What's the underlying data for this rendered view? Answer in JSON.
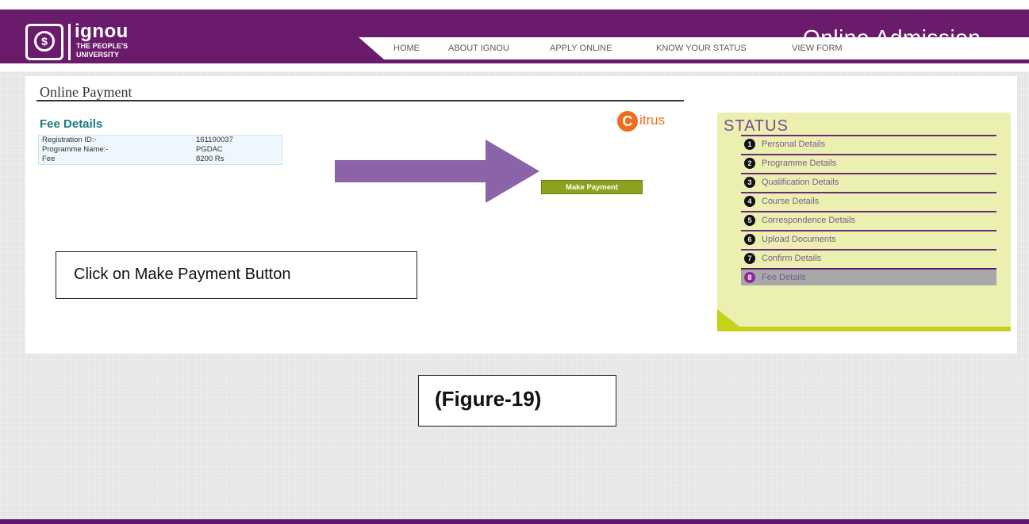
{
  "header": {
    "logo_word": "ignou",
    "logo_sub1": "THE PEOPLE'S",
    "logo_sub2": "UNIVERSITY",
    "site_title": "Online Admission",
    "nav": [
      "HOME",
      "ABOUT IGNOU",
      "APPLY ONLINE",
      "KNOW YOUR STATUS",
      "VIEW FORM"
    ]
  },
  "main": {
    "page_heading": "Online Payment",
    "fee_heading": "Fee Details",
    "fee_rows": [
      {
        "label": "Registration ID:-",
        "value": "161100037"
      },
      {
        "label": "Programme Name:-",
        "value": "PGDAC"
      },
      {
        "label": "Fee",
        "value": "8200 Rs"
      }
    ],
    "citrus_text": "itrus",
    "citrus_c": "C",
    "make_payment": "Make Payment",
    "callout": "Click on Make Payment Button"
  },
  "status": {
    "title": "STATUS",
    "items": [
      {
        "num": "1",
        "label": "Personal Details"
      },
      {
        "num": "2",
        "label": "Programme Details"
      },
      {
        "num": "3",
        "label": "Qualification Details"
      },
      {
        "num": "4",
        "label": "Course Details"
      },
      {
        "num": "5",
        "label": "Correspondence Details"
      },
      {
        "num": "6",
        "label": "Upload Documents"
      },
      {
        "num": "7",
        "label": "Confirm Details"
      },
      {
        "num": "8",
        "label": "Fee Details"
      }
    ],
    "active_index": 7
  },
  "figure_caption": "(Figure-19)",
  "colors": {
    "header_purple": "#6b1b6b",
    "fee_heading": "#1c7a7a",
    "make_payment_button": "#8aa21d",
    "status_bg": "#ebf0b0",
    "citrus_orange": "#f26b1d",
    "arrow": "#8b63a8"
  }
}
